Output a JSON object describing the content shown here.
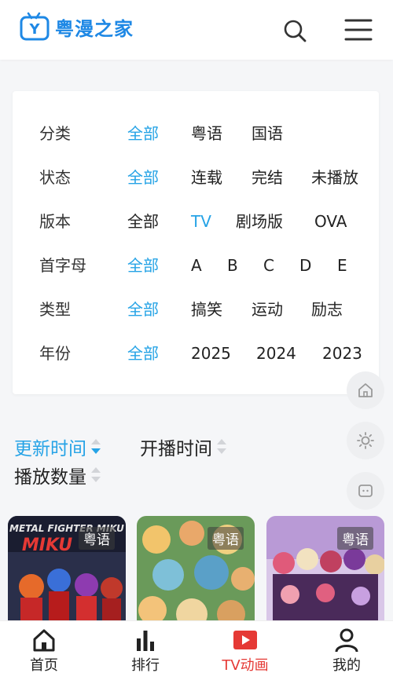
{
  "header": {
    "logo_text": "粤漫之家",
    "logo_glyph": "Y",
    "brand_color": "#1e88e5",
    "search_icon": "search-icon",
    "menu_icon": "menu-icon"
  },
  "filters": {
    "accent_color": "#26a3e6",
    "rows": [
      {
        "label": "分类",
        "options": [
          "全部",
          "粤语",
          "国语"
        ],
        "selected": "全部"
      },
      {
        "label": "状态",
        "options": [
          "全部",
          "连载",
          "完结",
          "未播放"
        ],
        "selected": "全部"
      },
      {
        "label": "版本",
        "options": [
          "全部",
          "TV",
          "剧场版",
          "OVA"
        ],
        "selected": "TV"
      },
      {
        "label": "首字母",
        "options": [
          "全部",
          "A",
          "B",
          "C",
          "D",
          "E"
        ],
        "selected": "全部"
      },
      {
        "label": "类型",
        "options": [
          "全部",
          "搞笑",
          "运动",
          "励志"
        ],
        "selected": "全部"
      },
      {
        "label": "年份",
        "options": [
          "全部",
          "2025",
          "2024",
          "2023"
        ],
        "selected": "全部"
      }
    ]
  },
  "sort": {
    "options": [
      "更新时间",
      "开播时间",
      "播放数量"
    ],
    "active": "更新时间",
    "direction": "descending"
  },
  "float_buttons": [
    "home-icon",
    "brightness-icon",
    "chat-icon"
  ],
  "cards": [
    {
      "tag": "粤语",
      "title_art": "METAL FIGHTER MIKU",
      "art_text": "MIKU"
    },
    {
      "tag": "粤语"
    },
    {
      "tag": "粤语"
    }
  ],
  "tabbar": {
    "items": [
      {
        "label": "首页",
        "icon": "home-icon"
      },
      {
        "label": "排行",
        "icon": "ranking-icon"
      },
      {
        "label": "TV动画",
        "icon": "play-icon"
      },
      {
        "label": "我的",
        "icon": "user-icon"
      }
    ],
    "active": "TV动画",
    "active_color": "#e53935"
  }
}
